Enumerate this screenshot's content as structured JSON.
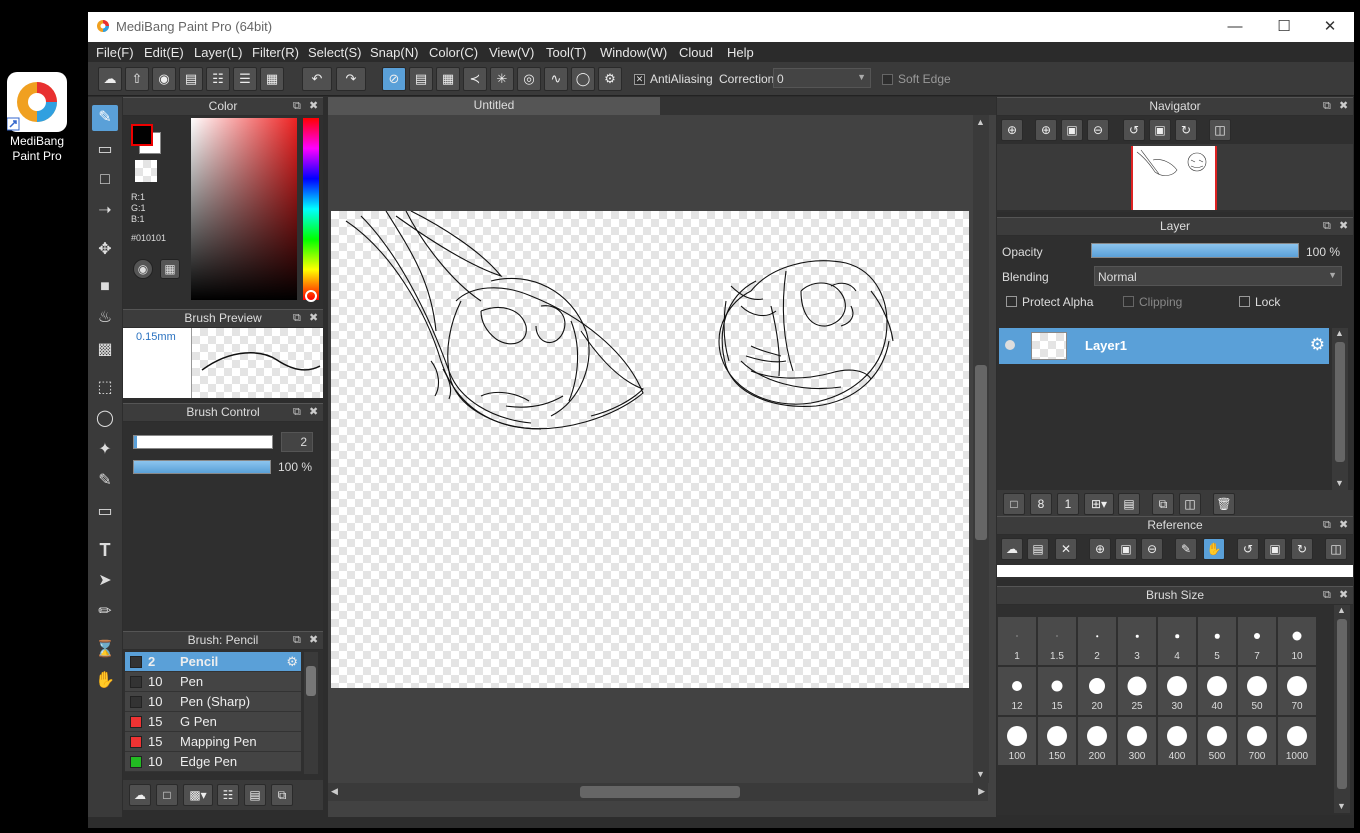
{
  "desktop_icon": {
    "label_line1": "MediBang",
    "label_line2": "Paint Pro"
  },
  "window": {
    "title": "MediBang Paint Pro (64bit)"
  },
  "menu": [
    "File(F)",
    "Edit(E)",
    "Layer(L)",
    "Filter(R)",
    "Select(S)",
    "Snap(N)",
    "Color(C)",
    "View(V)",
    "Tool(T)",
    "Window(W)",
    "Cloud",
    "Help"
  ],
  "toolbar": {
    "antialiasing_label": "AntiAliasing",
    "antialiasing_checked": true,
    "correction_label": "Correction",
    "correction_value": "0",
    "soft_edge_label": "Soft Edge",
    "soft_edge_checked": false
  },
  "color_panel": {
    "title": "Color",
    "r": "R:1",
    "g": "G:1",
    "b": "B:1",
    "hex": "#010101",
    "foreground": "#010101",
    "background": "#ffffff"
  },
  "brush_preview": {
    "title": "Brush Preview",
    "size": "0.15mm"
  },
  "brush_control": {
    "title": "Brush Control",
    "size_value": "2",
    "opacity_value": "100 %"
  },
  "brush_list": {
    "title": "Brush: Pencil",
    "items": [
      {
        "size": "2",
        "name": "Pencil",
        "color": "#333333",
        "selected": true
      },
      {
        "size": "10",
        "name": "Pen",
        "color": "#333333",
        "selected": false
      },
      {
        "size": "10",
        "name": "Pen (Sharp)",
        "color": "#333333",
        "selected": false
      },
      {
        "size": "15",
        "name": "G Pen",
        "color": "#ee3333",
        "selected": false
      },
      {
        "size": "15",
        "name": "Mapping Pen",
        "color": "#ee3333",
        "selected": false
      },
      {
        "size": "10",
        "name": "Edge Pen",
        "color": "#22bb22",
        "selected": false
      }
    ]
  },
  "canvas": {
    "tab_title": "Untitled"
  },
  "navigator": {
    "title": "Navigator"
  },
  "layer_panel": {
    "title": "Layer",
    "opacity_label": "Opacity",
    "opacity_value": "100 %",
    "opacity_fraction": 1.0,
    "blending_label": "Blending",
    "blending_value": "Normal",
    "protect_alpha_label": "Protect Alpha",
    "clipping_label": "Clipping",
    "lock_label": "Lock",
    "layers": [
      {
        "name": "Layer1",
        "selected": true
      }
    ]
  },
  "reference": {
    "title": "Reference"
  },
  "brush_size": {
    "title": "Brush Size",
    "sizes": [
      "1",
      "1.5",
      "2",
      "3",
      "4",
      "5",
      "7",
      "10",
      "12",
      "15",
      "20",
      "25",
      "30",
      "40",
      "50",
      "70",
      "100",
      "150",
      "200",
      "300",
      "400",
      "500",
      "700",
      "1000"
    ]
  }
}
